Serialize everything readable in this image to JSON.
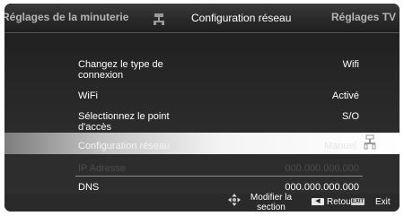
{
  "header": {
    "tabs": [
      {
        "label": "Réglages de la minuterie"
      },
      {
        "label": "Configuration réseau",
        "active": true
      },
      {
        "label": "Réglages TV"
      }
    ],
    "tab_icon": "network-icon"
  },
  "settings": {
    "connection_type": {
      "label": "Changez le type de connexion",
      "value": "Wifi"
    },
    "wifi": {
      "label": "WiFi",
      "value": "Activé"
    },
    "access_point": {
      "label": "Sélectionnez le point d'accès",
      "value": "S/O"
    },
    "network_config": {
      "label": "Configuration réseau",
      "value": "Manuel",
      "selected": true,
      "icon": "network-icon"
    },
    "ip_address": {
      "label": "IP Adresse",
      "value": "000.000.000.000",
      "disabled": true
    },
    "dns": {
      "label": "DNS",
      "value": "000.000.000.000"
    }
  },
  "footer": {
    "modifier_label": "Modifier la section",
    "modifier_icon": "dpad-icon",
    "back_label": "Retour",
    "back_icon": "back-arrow-icon",
    "exit_key_label": "EXIT",
    "exit_label": "Exit"
  },
  "colors": {
    "panel_background": "#262626",
    "text": "#ffffff",
    "disabled_text": "#4b4b4b",
    "inactive_tab": "#b5b5b5"
  }
}
